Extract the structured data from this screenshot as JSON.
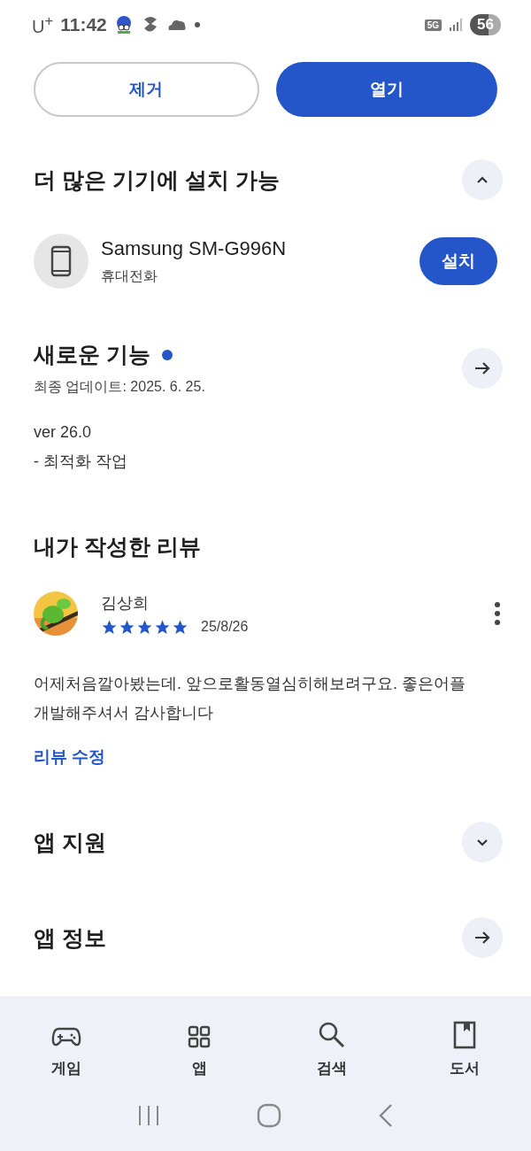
{
  "status_bar": {
    "carrier": "U$^{+}$",
    "time": "11:42",
    "network": "5G",
    "battery": "56"
  },
  "buttons": [
    {
      "label": "제거",
      "kind": "outline"
    },
    {
      "label": "열기",
      "kind": "filled"
    }
  ],
  "devices_section": {
    "title": "더 많은 기기에 설치 가능",
    "expanded": true,
    "device": {
      "name": "Samsung SM-G996N",
      "type": "휴대전화",
      "button": "설치"
    }
  },
  "whats_new": {
    "title": "새로운 기능",
    "new": true,
    "updated": "최종 업데이트: 2025. 6. 25.",
    "lines": [
      "ver 26.0",
      "- 최적화 작업"
    ]
  },
  "my_review": {
    "title": "내가 작성한 리뷰",
    "author": "김상희",
    "stars": 5,
    "date": "25/8/26",
    "text": "어제처음깔아봤는데. 앞으로활동열심히해보려구요. 좋은어플 개발해주셔서 감사합니다",
    "edit_link": "리뷰 수정"
  },
  "sections": [
    {
      "title": "앱 지원",
      "kind": "toggle",
      "expanded": false
    },
    {
      "title": "앱 정보",
      "kind": "link"
    }
  ],
  "bottom_nav": [
    {
      "label": "게임",
      "kind": "games"
    },
    {
      "label": "앱",
      "kind": "apps"
    },
    {
      "label": "검색",
      "kind": "search"
    },
    {
      "label": "도서",
      "kind": "books"
    }
  ]
}
